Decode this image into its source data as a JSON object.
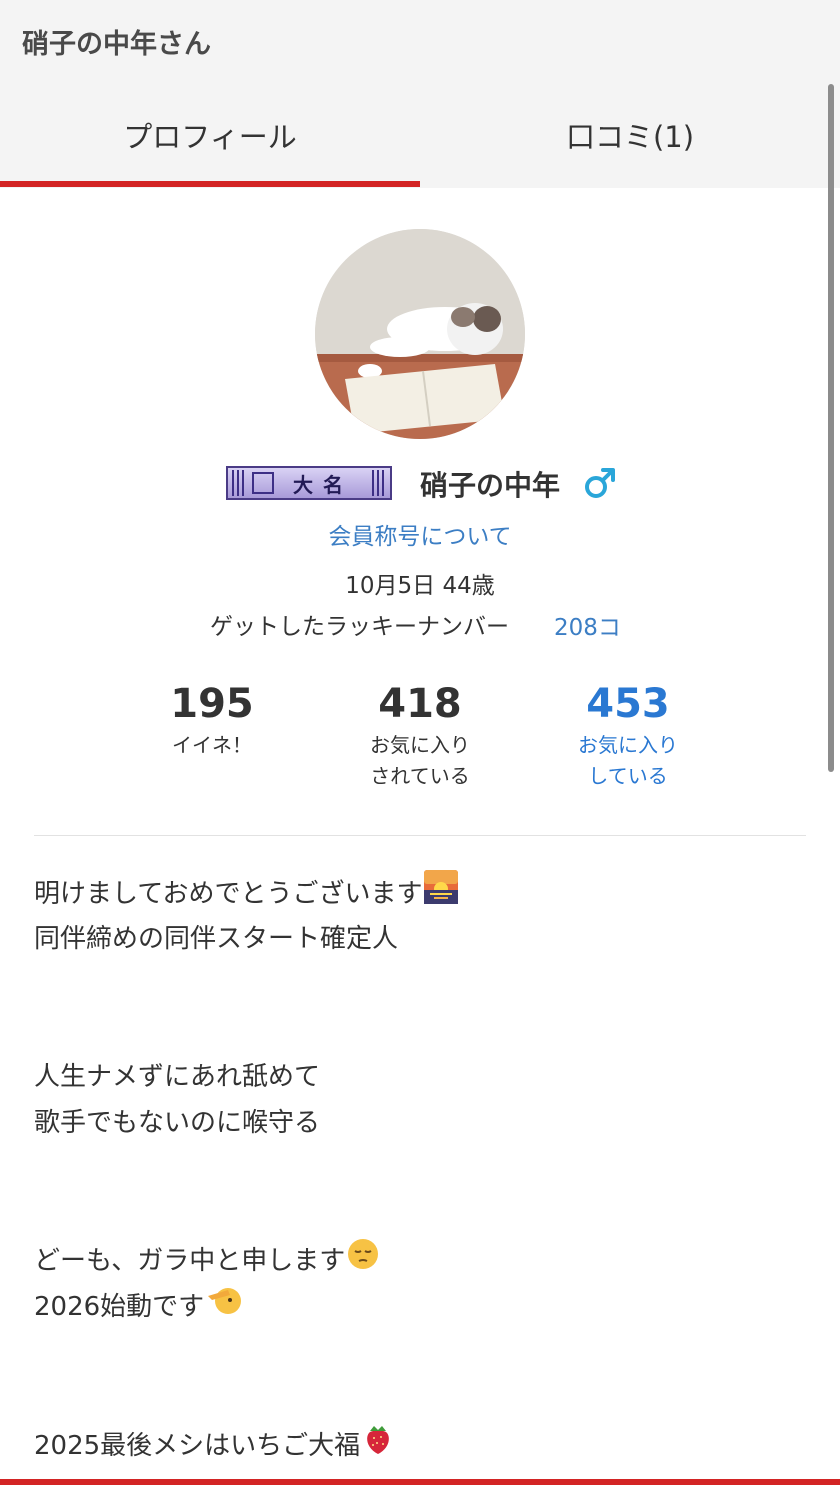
{
  "header": {
    "title": "硝子の中年さん"
  },
  "tabs": [
    {
      "label": "プロフィール",
      "active": true
    },
    {
      "label": "口コミ(1)",
      "active": false
    }
  ],
  "profile": {
    "badge_text": "大名",
    "username": "硝子の中年",
    "gender_icon": "male-symbol-icon",
    "title_link": "会員称号について",
    "birthday": "10月5日 44歳",
    "lucky_label": "ゲットしたラッキーナンバー",
    "lucky_value": "208コ"
  },
  "stats": [
    {
      "value": "195",
      "label1": "イイネ！",
      "label2": ""
    },
    {
      "value": "418",
      "label1": "お気に入り",
      "label2": "されている"
    },
    {
      "value": "453",
      "label1": "お気に入り",
      "label2": "している"
    }
  ],
  "bio": {
    "line1": "明けましておめでとうございます",
    "line2": "同伴締めの同伴スタート確定人",
    "line3": "人生ナメずにあれ舐めて",
    "line4": "歌手でもないのに喉守る",
    "line5": "どーも、ガラ中と申します",
    "line6": "2026始動です",
    "line7": "2025最後メシはいちご大福"
  },
  "colors": {
    "accent_red": "#d32424",
    "link_blue": "#3c7ec4",
    "stat_blue": "#2a78d2",
    "gender_blue": "#2aa6d9"
  }
}
